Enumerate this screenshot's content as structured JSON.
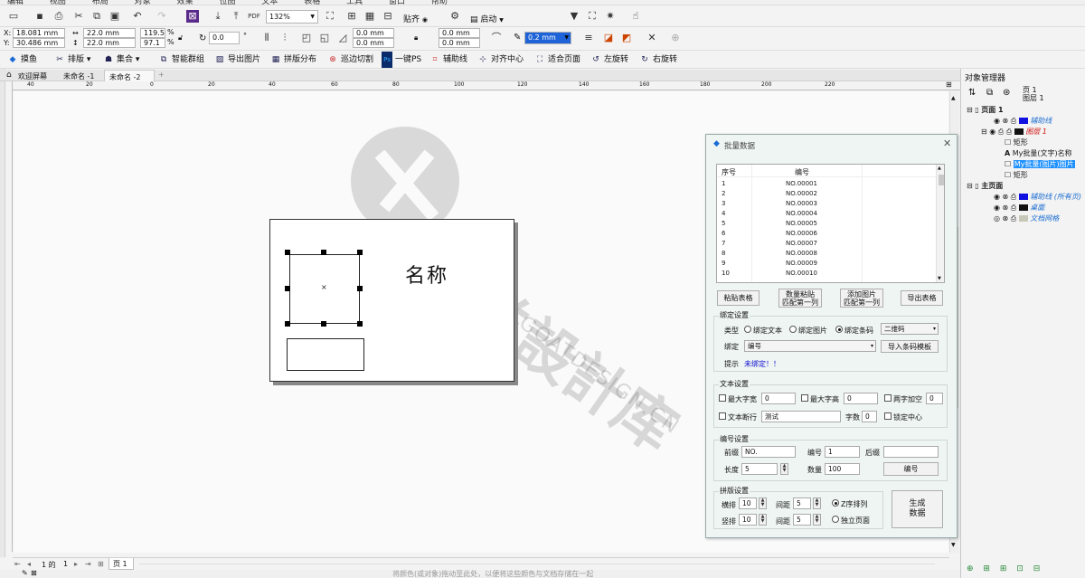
{
  "menubar": [
    "编辑",
    "视图",
    "布局",
    "对象",
    "效果",
    "位图",
    "文本",
    "表格",
    "工具",
    "窗口",
    "帮助"
  ],
  "toolbar1": {
    "zoom_value": "132%",
    "snap_label": "贴齐",
    "launch_label": "启动"
  },
  "propbar": {
    "x_value": "18.081 mm",
    "y_value": "30.486 mm",
    "width_value": "22.0 mm",
    "height_value": "22.0 mm",
    "scale_x": "119.5",
    "scale_y": "97.1",
    "percent": "%",
    "rotation_value": "0.0",
    "corner_values": [
      "0.0 mm",
      "0.0 mm",
      "0.0 mm",
      "0.0 mm"
    ],
    "outline_value": "0.2 mm"
  },
  "plugin_toolbar": [
    {
      "icon": "fish-icon",
      "label": "摸鱼"
    },
    {
      "icon": "scissors-icon",
      "label": "排版"
    },
    {
      "icon": "bag-icon",
      "label": "集合"
    },
    {
      "icon": "group-icon",
      "label": "智能群组"
    },
    {
      "icon": "image-icon",
      "label": "导出图片"
    },
    {
      "icon": "grid-icon",
      "label": "拼版分布"
    },
    {
      "icon": "cut-icon",
      "label": "巡边切割"
    },
    {
      "icon": "ps-icon",
      "label": "一键PS"
    },
    {
      "icon": "guideline-icon",
      "label": "辅助线"
    },
    {
      "icon": "align-icon",
      "label": "对齐中心"
    },
    {
      "icon": "fit-icon",
      "label": "适合页面"
    },
    {
      "icon": "rotate-left-icon",
      "label": "左旋转"
    },
    {
      "icon": "rotate-right-icon",
      "label": "右旋转"
    }
  ],
  "doc_tabs": [
    {
      "label": "欢迎屏幕"
    },
    {
      "label": "未命名 -1"
    },
    {
      "label": "未命名 -2"
    }
  ],
  "ruler_ticks": [
    "40",
    "20",
    "0",
    "20",
    "40",
    "60",
    "80",
    "100",
    "120",
    "140",
    "160",
    "180",
    "200",
    "220"
  ],
  "canvas": {
    "text_object": "名称"
  },
  "watermark": {
    "logo_text": "山羊設計库",
    "url_text": "WWW.GOATDESIGN.CN"
  },
  "dialog": {
    "title": "批量数据",
    "table_headers": [
      "序号",
      "编号"
    ],
    "rows": [
      [
        "1",
        "NO.00001"
      ],
      [
        "2",
        "NO.00002"
      ],
      [
        "3",
        "NO.00003"
      ],
      [
        "4",
        "NO.00004"
      ],
      [
        "5",
        "NO.00005"
      ],
      [
        "6",
        "NO.00006"
      ],
      [
        "7",
        "NO.00007"
      ],
      [
        "8",
        "NO.00008"
      ],
      [
        "9",
        "NO.00009"
      ],
      [
        "10",
        "NO.00010"
      ]
    ],
    "buttons": {
      "paste_table": "粘贴表格",
      "bulk_paste_line1": "数量粘贴",
      "bulk_paste_line2": "匹配第一列",
      "add_image_line1": "添加图片",
      "add_image_line2": "匹配第一列",
      "export_table": "导出表格"
    },
    "bind": {
      "section": "绑定设置",
      "type_label": "类型",
      "radio_text": "绑定文本",
      "radio_image": "绑定图片",
      "radio_barcode": "绑定条码",
      "barcode_type": "二维码",
      "bind_label": "绑定",
      "bind_value": "编号",
      "import_template": "导入条码模板",
      "hint_label": "提示",
      "hint_value": "未绑定！！"
    },
    "text": {
      "section": "文本设置",
      "max_width_label": "最大字宽",
      "max_width_value": "0",
      "max_height_label": "最大字高",
      "max_height_value": "0",
      "spacing_label": "两字加空",
      "spacing_value": "0",
      "line_break_label": "文本断行",
      "line_break_value": "测试",
      "char_count_label": "字数",
      "char_count_value": "0",
      "lock_center_label": "锁定中心"
    },
    "numbering": {
      "section": "编号设置",
      "prefix_label": "前缀",
      "prefix_value": "NO.",
      "number_label": "编号",
      "number_value": "1",
      "suffix_label": "后缀",
      "suffix_value": "",
      "length_label": "长度",
      "length_value": "5",
      "count_label": "数量",
      "count_value": "100",
      "number_button": "编号"
    },
    "imposition": {
      "section": "拼版设置",
      "cols_label": "横排",
      "cols_value": "10",
      "hgap_label": "间距",
      "hgap_value": "5",
      "z_order": "Z序排列",
      "rows_label": "竖排",
      "rows_value": "10",
      "vgap_label": "间距",
      "vgap_value": "5",
      "separate_pages": "独立页面",
      "generate_line1": "生成",
      "generate_line2": "数据"
    }
  },
  "object_manager": {
    "title": "对象管理器",
    "page_label": "页 1",
    "layer_label": "图层 1",
    "items": [
      {
        "text": "页面 1",
        "color": "#1a1a1a",
        "swatch": ""
      },
      {
        "text": "辅助线",
        "color": "#1f6fd1",
        "swatch": "#1010e0"
      },
      {
        "text": "图层 1",
        "color": "#d01010",
        "swatch": "#111111"
      },
      {
        "text": "矩形",
        "color": "#1a1a1a",
        "swatch": ""
      },
      {
        "text": "My批量(文字)名称",
        "color": "#1a1a1a",
        "swatch": ""
      },
      {
        "text": "My批量(图片)图片",
        "color": "#1a1a1a",
        "swatch": ""
      },
      {
        "text": "矩形",
        "color": "#1a1a1a",
        "swatch": ""
      },
      {
        "text": "主页面",
        "color": "#1a1a1a",
        "swatch": ""
      },
      {
        "text": "辅助线 (所有页)",
        "color": "#1f6fd1",
        "swatch": "#1010e0"
      },
      {
        "text": "桌面",
        "color": "#1f6fd1",
        "swatch": "#111111"
      },
      {
        "text": "文档网格",
        "color": "#1f6fd1",
        "swatch": "#c8c8b8"
      }
    ]
  },
  "page_nav": {
    "page_counter_prefix": "1 的",
    "page_counter_total": "1",
    "page_tab": "页 1"
  },
  "statusbar": {
    "hint": "将颜色(或对象)拖动至此处，以便将这些颜色与文档存储在一起"
  }
}
